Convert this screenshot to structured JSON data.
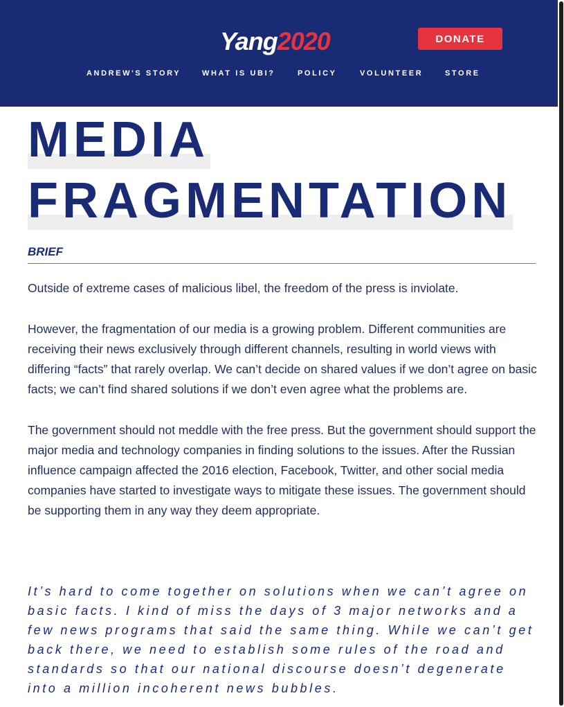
{
  "header": {
    "logo": {
      "brand": "Yang",
      "year": "2020"
    },
    "donate_label": "DONATE",
    "nav": [
      {
        "label": "ANDREW'S STORY"
      },
      {
        "label": "WHAT IS UBI?"
      },
      {
        "label": "POLICY"
      },
      {
        "label": "VOLUNTEER"
      },
      {
        "label": "STORE"
      }
    ]
  },
  "page": {
    "title_line1": "MEDIA",
    "title_line2": "FRAGMENTATION",
    "section_label": "BRIEF",
    "paragraphs": [
      "Outside of extreme cases of malicious libel, the freedom of the press is inviolate.",
      "However, the fragmentation of our media is a growing problem. Different communities are receiving their news exclusively through different channels, resulting in world views with differing “facts” that rarely overlap. We can’t decide on shared values if we don’t agree on basic facts; we can’t find shared solutions if we don’t even agree what the problems are.",
      "The government should not meddle with the free press. But the government should support the major media and technology companies in finding solutions to the issues. After the Russian influence campaign affected the 2016 election, Facebook, Twitter, and other social media companies have started to investigate ways to mitigate these issues. The government should be supporting them in any way they deem appropriate."
    ],
    "quote": "It’s hard to come together on solutions when we can’t agree on basic facts. I kind of miss the days of 3 major networks and a few news programs that said the same thing. While we can’t get back there, we need to establish some rules of the road and standards so that our national discourse doesn’t degenerate into a million incoherent news bubbles."
  },
  "colors": {
    "navy": "#1a2b76",
    "red": "#e5343f",
    "body_text": "#1f2d5c"
  }
}
